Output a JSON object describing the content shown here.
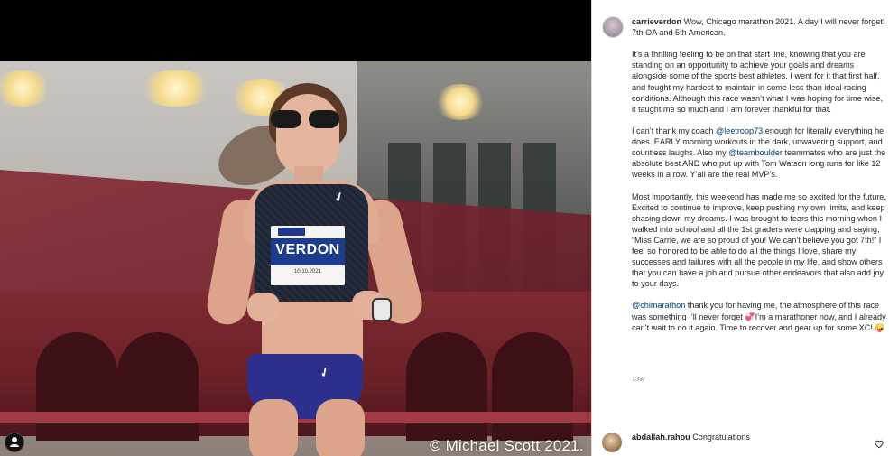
{
  "post": {
    "username": "carrieverdon",
    "caption": {
      "p1": "Wow, Chicago marathon 2021. A day I will never forget! 7th OA and 5th American.",
      "p2": "It’s a thrilling feeling to be on that start line, knowing that you are standing on an opportunity to achieve your goals and dreams alongside some of the sports best athletes. I went for it that first half, and fought my hardest to maintain in some less than ideal racing conditions. Although this race wasn’t what I was hoping for time wise, it taught me so much and I am forever thankful for that.",
      "p3a": "I can’t thank my coach ",
      "p3_mention1": "@leetroop73",
      "p3b": " enough for literally everything he does. EARLY morning workouts in the dark, unwavering support, and countless laughs. Also my ",
      "p3_mention2": "@teamboulder",
      "p3c": " teammates who are just the absolute best AND who put up with Tom Watson long runs for like 12 weeks in a row. Y’all are the real MVP’s.",
      "p4": "Most importantly, this weekend has made me so excited for the future. Excited to continue to improve, keep pushing my own limits, and keep chasing down my dreams. I was brought to tears this morning when I walked into school and all the 1st graders were clapping and saying, “Miss Carrie, we are so proud of you! We can’t believe you got 7th!” I feel so honored to be able to do all the things I love, share my successes and failures with all the people in my life, and show others that you can have a job and pursue other endeavors that also add joy to your days.",
      "p5_mention": "@chimarathon",
      "p5a": " thank you for having me, the atmosphere of this race was something I’ll never forget ",
      "p5_emoji1": "💞",
      "p5b": "I’m a marathoner now, and I already can’t wait to do it again. Time to recover and gear up for some XC! ",
      "p5_emoji2": "🤪"
    },
    "time_ago": "13w",
    "photo": {
      "bib_name": "VERDON",
      "bib_date": "10.10.2021",
      "copyright": "© Michael Scott 2021."
    }
  },
  "comments": [
    {
      "username": "abdallah.rahou",
      "text": "Congratulations"
    }
  ],
  "icons": {
    "more_comments": "plus-circle-icon",
    "like": "heart-icon",
    "tagged_user": "user-icon"
  },
  "colors": {
    "mention": "#00376b",
    "text": "#262626",
    "muted": "#8e8e8e"
  }
}
